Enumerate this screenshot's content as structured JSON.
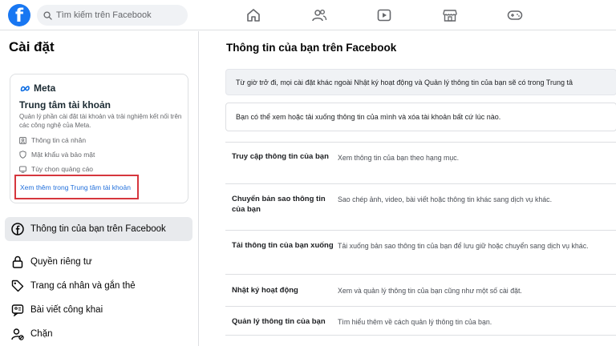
{
  "topbar": {
    "logo_letter": "f",
    "search_placeholder": "Tìm kiếm trên Facebook",
    "nav_icons": [
      "home-icon",
      "friends-icon",
      "watch-icon",
      "marketplace-icon",
      "gaming-icon"
    ]
  },
  "sidebar": {
    "title": "Cài đặt",
    "accounts_center": {
      "brand": "Meta",
      "title": "Trung tâm tài khoản",
      "description": "Quản lý phần cài đặt tài khoản và trải nghiệm kết nối trên các công nghệ của Meta.",
      "items": [
        {
          "label": "Thông tin cá nhân",
          "icon": "personal-details-icon"
        },
        {
          "label": "Mật khẩu và bảo mật",
          "icon": "shield-icon"
        },
        {
          "label": "Tùy chọn quảng cáo",
          "icon": "ad-preferences-icon"
        }
      ],
      "link": "Xem thêm trong Trung tâm tài khoản"
    },
    "menu": [
      {
        "label": "Thông tin của bạn trên Facebook",
        "icon": "facebook-circle-icon",
        "active": true
      },
      {
        "label": "Quyền riêng tư",
        "icon": "lock-icon",
        "active": false
      },
      {
        "label": "Trang cá nhân và gắn thẻ",
        "icon": "tag-icon",
        "active": false
      },
      {
        "label": "Bài viết công khai",
        "icon": "public-post-icon",
        "active": false
      },
      {
        "label": "Chặn",
        "icon": "block-user-icon",
        "active": false
      }
    ]
  },
  "main": {
    "title": "Thông tin của bạn trên Facebook",
    "notice": "Từ giờ trở đi, mọi cài đặt khác ngoài Nhật ký hoạt động và Quản lý thông tin của bạn sẽ có trong Trung tâ",
    "info": "Bạn có thể xem hoặc tải xuống thông tin của mình và xóa tài khoản bất cứ lúc nào.",
    "options": [
      {
        "label": "Truy cập thông tin của bạn",
        "description": "Xem thông tin của bạn theo hạng mục."
      },
      {
        "label": "Chuyển bản sao thông tin của bạn",
        "description": "Sao chép ảnh, video, bài viết hoặc thông tin khác sang dịch vụ khác."
      },
      {
        "label": "Tải thông tin của bạn xuống",
        "description": "Tải xuống bản sao thông tin của bạn để lưu giữ hoặc chuyển sang dịch vụ khác."
      },
      {
        "label": "Nhật ký hoạt động",
        "description": "Xem và quản lý thông tin của bạn cũng như một số cài đặt."
      },
      {
        "label": "Quản lý thông tin của bạn",
        "description": "Tìm hiểu thêm về cách quản lý thông tin của bạn."
      }
    ]
  },
  "colors": {
    "facebook_blue": "#1877f2",
    "link_blue": "#216fdb",
    "highlight_red": "#d6363d"
  }
}
